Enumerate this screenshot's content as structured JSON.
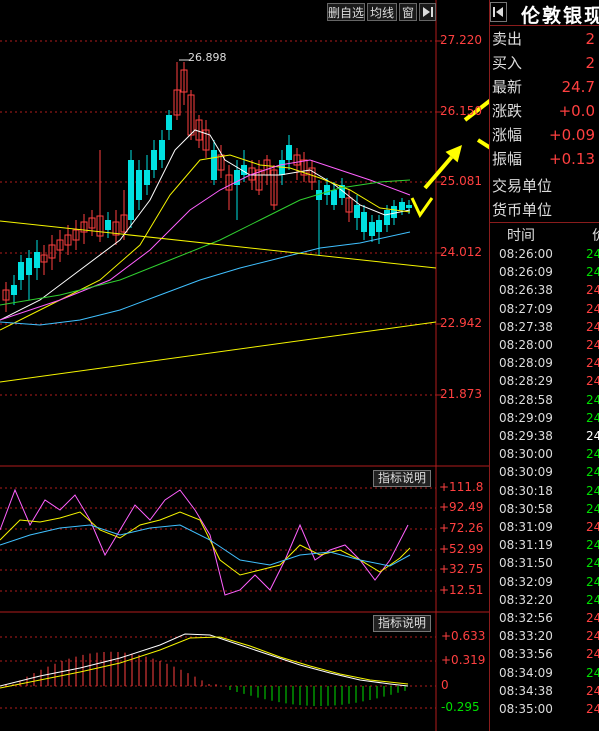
{
  "toolbar": {
    "delete_watchlist_label": "删自选",
    "ma_line_label": "均线",
    "window_label": "窗",
    "expand_icon": "play-to-end-icon"
  },
  "main_chart": {
    "price_levels": [
      "27.220",
      "26.150",
      "25.081",
      "24.012",
      "22.942",
      "21.873"
    ],
    "peak_annotation": "26.898"
  },
  "rsi_panel": {
    "explain_label": "指标说明",
    "levels": [
      "+111.8",
      "+92.49",
      "+72.26",
      "+52.99",
      "+32.75",
      "+12.51"
    ]
  },
  "macd_panel": {
    "explain_label": "指标说明",
    "levels": [
      "+0.633",
      "+0.319",
      "0",
      "-0.295"
    ]
  },
  "quote_panel": {
    "collapse_icon": "left-arrow-icon",
    "title": "伦敦银现",
    "rows": [
      {
        "label": "卖出",
        "value": "2"
      },
      {
        "label": "买入",
        "value": "2"
      },
      {
        "label": "最新",
        "value": "24.7"
      },
      {
        "label": "涨跌",
        "value": "+0.0"
      },
      {
        "label": "涨幅",
        "value": "+0.09"
      },
      {
        "label": "振幅",
        "value": "+0.13"
      },
      {
        "label": "交易单位",
        "value": ""
      },
      {
        "label": "货币单位",
        "value": ""
      }
    ],
    "ticks_header_time": "时间",
    "ticks_header_price": "价",
    "ticks": [
      {
        "time": "08:26:00",
        "price": "24",
        "dir": "down"
      },
      {
        "time": "08:26:09",
        "price": "24",
        "dir": "down"
      },
      {
        "time": "08:26:38",
        "price": "24",
        "dir": "up"
      },
      {
        "time": "08:27:09",
        "price": "24",
        "dir": "up"
      },
      {
        "time": "08:27:38",
        "price": "24",
        "dir": "up"
      },
      {
        "time": "08:28:00",
        "price": "24",
        "dir": "up"
      },
      {
        "time": "08:28:09",
        "price": "24",
        "dir": "up"
      },
      {
        "time": "08:28:29",
        "price": "24",
        "dir": "up"
      },
      {
        "time": "08:28:58",
        "price": "24",
        "dir": "down"
      },
      {
        "time": "08:29:09",
        "price": "24",
        "dir": "down"
      },
      {
        "time": "08:29:38",
        "price": "24",
        "dir": "flat"
      },
      {
        "time": "08:30:00",
        "price": "24",
        "dir": "down"
      },
      {
        "time": "08:30:09",
        "price": "24",
        "dir": "down"
      },
      {
        "time": "08:30:18",
        "price": "24",
        "dir": "down"
      },
      {
        "time": "08:30:58",
        "price": "24",
        "dir": "down"
      },
      {
        "time": "08:31:09",
        "price": "24",
        "dir": "up"
      },
      {
        "time": "08:31:19",
        "price": "24",
        "dir": "down"
      },
      {
        "time": "08:31:50",
        "price": "24",
        "dir": "down"
      },
      {
        "time": "08:32:09",
        "price": "24",
        "dir": "down"
      },
      {
        "time": "08:32:20",
        "price": "24",
        "dir": "down"
      },
      {
        "time": "08:32:56",
        "price": "24",
        "dir": "up"
      },
      {
        "time": "08:33:20",
        "price": "24",
        "dir": "up"
      },
      {
        "time": "08:33:56",
        "price": "24",
        "dir": "up"
      },
      {
        "time": "08:34:09",
        "price": "24",
        "dir": "down"
      },
      {
        "time": "08:34:38",
        "price": "24",
        "dir": "up"
      },
      {
        "time": "08:35:00",
        "price": "24",
        "dir": "up"
      }
    ]
  },
  "colors": {
    "up": "#ff4040",
    "down": "#00e0e0",
    "tick_down": "#00e000",
    "flat": "#ffffff",
    "axis": "#b01c1c",
    "ma_white": "#ffffff",
    "ma_yellow": "#f5f500",
    "ma_magenta": "#ff60ff",
    "ma_green": "#30d030",
    "ma_cyan": "#40c0ff",
    "arrow": "#ffff00"
  }
}
